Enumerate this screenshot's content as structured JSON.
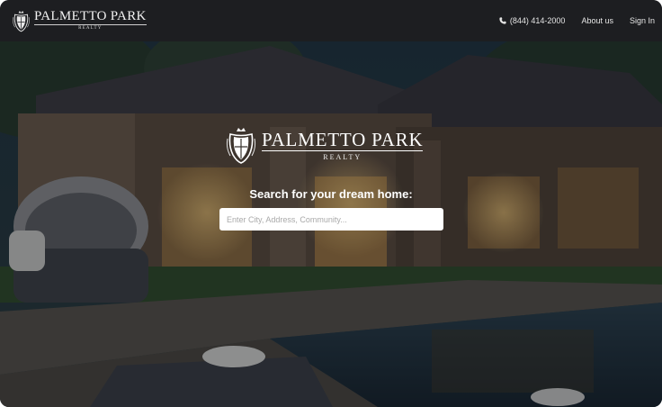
{
  "header": {
    "brand_name": "PALMETTO PARK",
    "brand_sub": "REALTY",
    "phone": "(844) 414-2000",
    "about_label": "About us",
    "signin_label": "Sign In"
  },
  "hero": {
    "logo_name": "PALMETTO PARK",
    "logo_sub": "REALTY",
    "search_heading": "Search for your dream home:",
    "search_placeholder": "Enter City, Address, Community...",
    "search_value": ""
  },
  "icons": {
    "phone": "phone-icon",
    "crest": "crest-icon"
  },
  "colors": {
    "header_bg": "#1d1e21",
    "text_light": "#e6e6e6",
    "input_bg": "#ffffff"
  }
}
